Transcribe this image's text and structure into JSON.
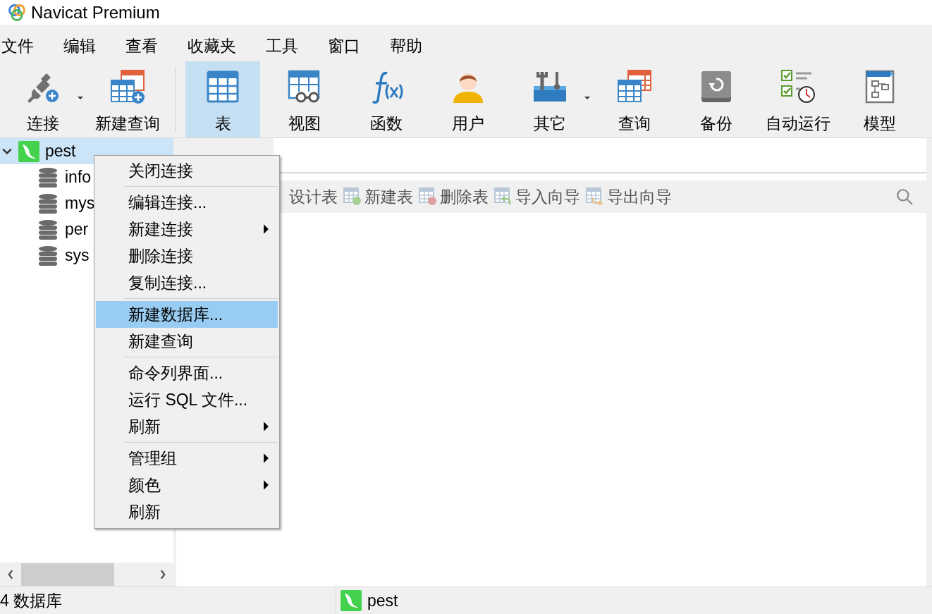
{
  "window": {
    "title": "Navicat Premium"
  },
  "menu_bar": [
    "文件",
    "编辑",
    "查看",
    "收藏夹",
    "工具",
    "窗口",
    "帮助"
  ],
  "toolbar": [
    {
      "label": "连接",
      "selected": false,
      "dropdown": true
    },
    {
      "label": "新建查询",
      "selected": false,
      "dropdown": false
    },
    {
      "label": "表",
      "selected": true,
      "dropdown": false
    },
    {
      "label": "视图",
      "selected": false,
      "dropdown": false
    },
    {
      "label": "函数",
      "selected": false,
      "dropdown": false
    },
    {
      "label": "用户",
      "selected": false,
      "dropdown": false
    },
    {
      "label": "其它",
      "selected": false,
      "dropdown": true
    },
    {
      "label": "查询",
      "selected": false,
      "dropdown": false
    },
    {
      "label": "备份",
      "selected": false,
      "dropdown": false
    },
    {
      "label": "自动运行",
      "selected": false,
      "dropdown": false
    },
    {
      "label": "模型",
      "selected": false,
      "dropdown": false
    }
  ],
  "tree": [
    {
      "label": "pest",
      "selected": true,
      "expanded": true,
      "children": [
        {
          "label": "info"
        },
        {
          "label": "mys"
        },
        {
          "label": "per"
        },
        {
          "label": "sys"
        }
      ]
    }
  ],
  "object_toolbar": [
    "设计表",
    "新建表",
    "删除表",
    "导入向导",
    "导出向导"
  ],
  "context_menu": [
    {
      "kind": "item",
      "label": "关闭连接",
      "submenu": false,
      "selected": false
    },
    {
      "kind": "separator"
    },
    {
      "kind": "item",
      "label": "编辑连接...",
      "submenu": false,
      "selected": false
    },
    {
      "kind": "item",
      "label": "新建连接",
      "submenu": true,
      "selected": false
    },
    {
      "kind": "item",
      "label": "删除连接",
      "submenu": false,
      "selected": false
    },
    {
      "kind": "item",
      "label": "复制连接...",
      "submenu": false,
      "selected": false
    },
    {
      "kind": "separator"
    },
    {
      "kind": "item",
      "label": "新建数据库...",
      "submenu": false,
      "selected": true
    },
    {
      "kind": "item",
      "label": "新建查询",
      "submenu": false,
      "selected": false
    },
    {
      "kind": "separator"
    },
    {
      "kind": "item",
      "label": "命令列界面...",
      "submenu": false,
      "selected": false
    },
    {
      "kind": "item",
      "label": "运行 SQL 文件...",
      "submenu": false,
      "selected": false
    },
    {
      "kind": "item",
      "label": "刷新",
      "submenu": true,
      "selected": false
    },
    {
      "kind": "separator"
    },
    {
      "kind": "item",
      "label": "管理组",
      "submenu": true,
      "selected": false
    },
    {
      "kind": "item",
      "label": "颜色",
      "submenu": true,
      "selected": false
    },
    {
      "kind": "item",
      "label": "刷新",
      "submenu": false,
      "selected": false
    }
  ],
  "status_bar": {
    "left": "4 数据库",
    "connection": "pest"
  }
}
